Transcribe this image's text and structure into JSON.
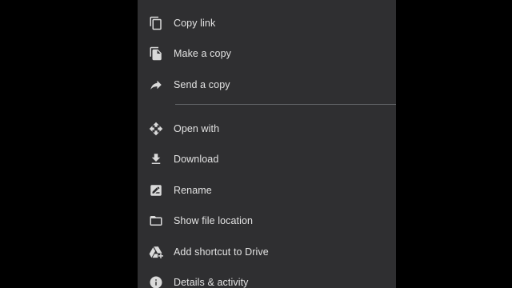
{
  "menu": {
    "items": [
      {
        "label": "Copy link",
        "icon": "copy-link-icon"
      },
      {
        "label": "Make a copy",
        "icon": "make-copy-icon"
      },
      {
        "label": "Send a copy",
        "icon": "share-arrow-icon"
      },
      {
        "label": "Open with",
        "icon": "open-with-icon"
      },
      {
        "label": "Download",
        "icon": "download-icon"
      },
      {
        "label": "Rename",
        "icon": "rename-icon"
      },
      {
        "label": "Show file location",
        "icon": "folder-icon"
      },
      {
        "label": "Add shortcut to Drive",
        "icon": "drive-shortcut-icon"
      },
      {
        "label": "Details & activity",
        "icon": "info-icon"
      }
    ]
  },
  "colors": {
    "background": "#000000",
    "sheet": "#2f2f31",
    "text": "#e3e3e3",
    "icon": "#dadada",
    "divider": "#5f6164"
  }
}
